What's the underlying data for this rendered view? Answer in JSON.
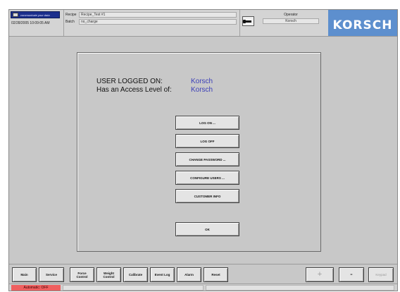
{
  "header": {
    "logo_text": "communicate your data",
    "datetime": "02/28/2005 10:09:05 AM",
    "recipe_label": "Recipe",
    "recipe_value": "Recipe_Test #1",
    "batch_label": "Batch",
    "batch_value": "no_charge",
    "operator_label": "Operator",
    "operator_value": "Korsch",
    "brand": "KORSCH",
    "brand_color": "#5d8fce"
  },
  "dialog": {
    "user_label": "USER LOGGED ON:",
    "user_value": "Korsch",
    "access_label": "Has an Access Level of:",
    "access_value": "Korsch",
    "buttons": {
      "log_on": "LOG ON ...",
      "log_off": "LOG OFF",
      "change_password": "CHANGE PASSWORD ...",
      "configure_users": "CONFIGURE USERS ...",
      "customer_info": "CUSTOMER INFO",
      "ok": "OK"
    }
  },
  "nav": {
    "main": "Main",
    "service": "Service",
    "force_control": "Force\nControl",
    "weight_control": "Weight\nControl",
    "calibrate": "Calibrate",
    "event_log": "Event Log",
    "alarm": "Alarm",
    "reset": "Reset",
    "plus": "+",
    "minus": "-",
    "keypad": "Keypad"
  },
  "status": {
    "automatic": "Automatic: OFF",
    "status_color": "#ef5f5f"
  }
}
